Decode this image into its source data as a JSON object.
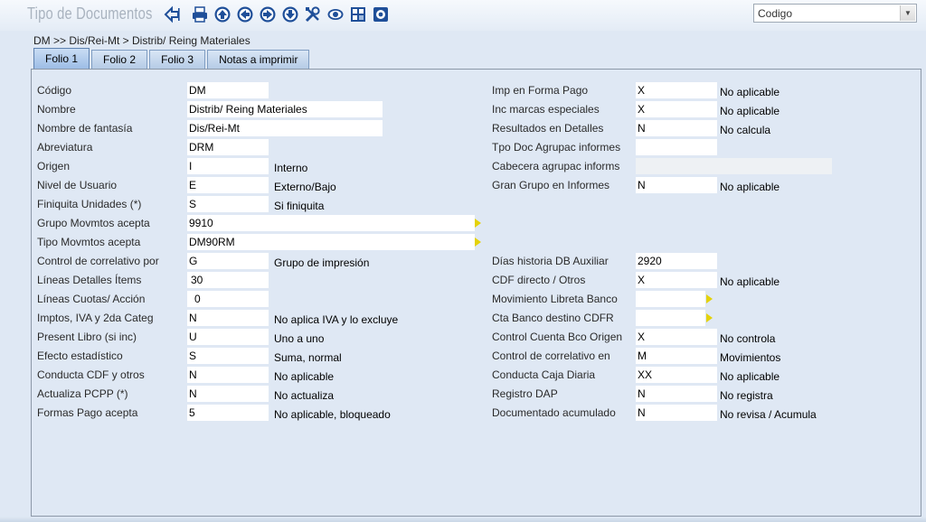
{
  "header": {
    "title": "Tipo de Documentos",
    "select_value": "Codigo"
  },
  "toolbar": [
    {
      "name": "back-icon"
    },
    {
      "name": "print-icon"
    },
    {
      "name": "first-record-icon"
    },
    {
      "name": "previous-record-icon"
    },
    {
      "name": "next-record-icon"
    },
    {
      "name": "last-record-icon"
    },
    {
      "name": "tools-icon"
    },
    {
      "name": "view-icon"
    },
    {
      "name": "grid-icon"
    },
    {
      "name": "settings-icon"
    }
  ],
  "breadcrumb": "DM >> Dis/Rei-Mt > Distrib/ Reing Materiales",
  "tabs": [
    "Folio 1",
    "Folio 2",
    "Folio 3",
    "Notas a imprimir"
  ],
  "left": {
    "codigo": {
      "label": "Código",
      "value": "DM"
    },
    "nombre": {
      "label": "Nombre",
      "value": "Distrib/ Reing Materiales"
    },
    "fantasia": {
      "label": "Nombre de fantasía",
      "value": "Dis/Rei-Mt"
    },
    "abreviatura": {
      "label": "Abreviatura",
      "value": "DRM"
    },
    "origen": {
      "label": "Origen",
      "value": "I",
      "desc": "Interno"
    },
    "nivel": {
      "label": "Nivel de Usuario",
      "value": "E",
      "desc": "Externo/Bajo"
    },
    "finiquita": {
      "label": "Finiquita Unidades (*)",
      "value": "S",
      "desc": "Si finiquita"
    },
    "grupo_mov": {
      "label": "Grupo Movmtos acepta",
      "value": "9910"
    },
    "tipo_mov": {
      "label": "Tipo Movmtos acepta",
      "value": "DM90RM"
    },
    "correlativo": {
      "label": "Control de correlativo por",
      "value": "G",
      "desc": "Grupo de impresión"
    },
    "lineas_det": {
      "label": "Líneas Detalles Ítems",
      "value": "30"
    },
    "lineas_cuotas": {
      "label": "Líneas Cuotas/ Acción",
      "value": "0"
    },
    "imptos": {
      "label": "Imptos, IVA y 2da Categ",
      "value": "N",
      "desc": "No aplica IVA y lo excluye"
    },
    "present_libro": {
      "label": "Present Libro (si inc)",
      "value": "U",
      "desc": "Uno a uno"
    },
    "efecto": {
      "label": "Efecto estadístico",
      "value": "S",
      "desc": "Suma, normal"
    },
    "conducta_cdf": {
      "label": "Conducta CDF y otros",
      "value": "N",
      "desc": "No aplicable"
    },
    "actualiza": {
      "label": "Actualiza PCPP (*)",
      "value": "N",
      "desc": "No actualiza"
    },
    "formas_pago": {
      "label": "Formas Pago acepta",
      "value": "5",
      "desc": "No aplicable, bloqueado"
    }
  },
  "right": {
    "imp_forma": {
      "label": "Imp en Forma Pago",
      "value": "X",
      "desc": "No aplicable"
    },
    "inc_marcas": {
      "label": "Inc marcas especiales",
      "value": "X",
      "desc": "No aplicable"
    },
    "resultados": {
      "label": "Resultados en Detalles",
      "value": "N",
      "desc": "No calcula"
    },
    "tpo_doc": {
      "label": "Tpo Doc Agrupac informes",
      "value": ""
    },
    "cabecera": {
      "label": "Cabecera agrupac informs",
      "value": ""
    },
    "gran_grupo": {
      "label": "Gran Grupo en Informes",
      "value": "N",
      "desc": "No aplicable"
    },
    "dias_hist": {
      "label": "Días historia DB Auxiliar",
      "value": "2920"
    },
    "cdf_directo": {
      "label": "CDF directo / Otros",
      "value": "X",
      "desc": "No aplicable"
    },
    "mov_libreta": {
      "label": "Movimiento Libreta Banco",
      "value": ""
    },
    "cta_banco": {
      "label": "Cta Banco destino CDFR",
      "value": ""
    },
    "control_cta": {
      "label": "Control Cuenta Bco Origen",
      "value": "X",
      "desc": "No controla"
    },
    "control_corr": {
      "label": "Control de correlativo en",
      "value": "M",
      "desc": "Movimientos"
    },
    "conducta_caja": {
      "label": "Conducta Caja Diaria",
      "value": "XX",
      "desc": "No aplicable"
    },
    "registro_dap": {
      "label": "Registro DAP",
      "value": "N",
      "desc": "No registra"
    },
    "documentado": {
      "label": "Documentado acumulado",
      "value": "N",
      "desc": "No revisa / Acumula"
    }
  },
  "colors": {
    "picker": "#e4d20a",
    "toolbar_icon": "#1f4f99"
  }
}
